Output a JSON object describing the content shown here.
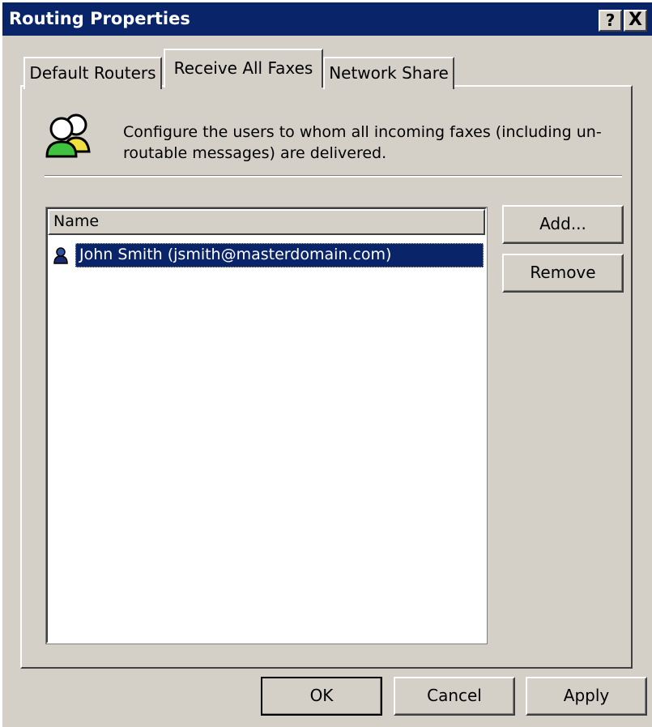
{
  "window": {
    "title": "Routing Properties",
    "help_label": "?",
    "close_label": "X"
  },
  "tabs": [
    {
      "label": "Default Routers",
      "active": false
    },
    {
      "label": "Receive All Faxes",
      "active": true
    },
    {
      "label": "Network Share",
      "active": false
    }
  ],
  "description": "Configure the users to whom all incoming faxes (including un-routable messages) are delivered.",
  "list": {
    "column_header": "Name",
    "rows": [
      {
        "label": "John Smith (jsmith@masterdomain.com)",
        "selected": true,
        "icon": "user-icon"
      }
    ]
  },
  "side_buttons": {
    "add_label": "Add...",
    "remove_label": "Remove"
  },
  "footer_buttons": {
    "ok_label": "OK",
    "cancel_label": "Cancel",
    "apply_label": "Apply"
  },
  "colors": {
    "titlebar": "#0a246a",
    "face": "#d4d0c8",
    "selection": "#0a246a"
  }
}
